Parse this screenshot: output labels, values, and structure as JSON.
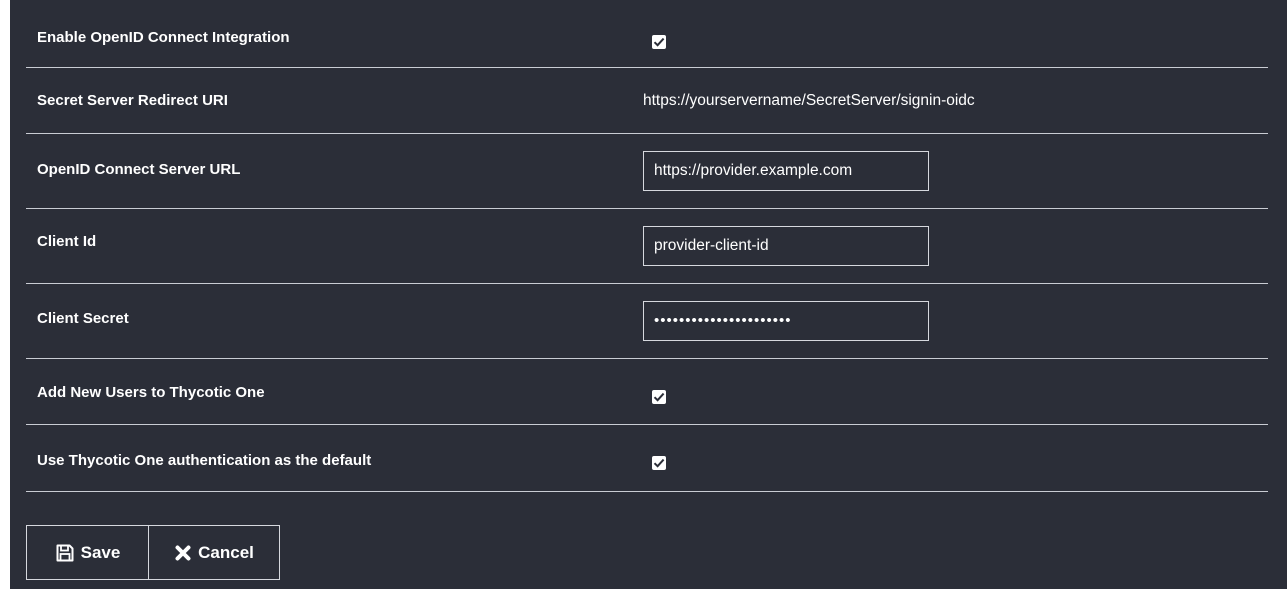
{
  "settings": {
    "enable_oidc": {
      "label": "Enable OpenID Connect Integration",
      "checked": true
    },
    "redirect_uri": {
      "label": "Secret Server Redirect URI",
      "value": "https://yourservername/SecretServer/signin-oidc"
    },
    "server_url": {
      "label": "OpenID Connect Server URL",
      "value": "https://provider.example.com"
    },
    "client_id": {
      "label": "Client Id",
      "value": "provider-client-id"
    },
    "client_secret": {
      "label": "Client Secret",
      "value": "••••••••••••••••••••••"
    },
    "add_new_users": {
      "label": "Add New Users to Thycotic One",
      "checked": true
    },
    "default_auth": {
      "label": "Use Thycotic One authentication as the default",
      "checked": true
    }
  },
  "actions": {
    "save_label": "Save",
    "save_icon": "floppy-disk-icon",
    "cancel_label": "Cancel",
    "cancel_icon": "x-mark-icon"
  },
  "colors": {
    "panel_background": "#2b2e38",
    "divider": "#c9ccd3",
    "text": "#ffffff"
  }
}
